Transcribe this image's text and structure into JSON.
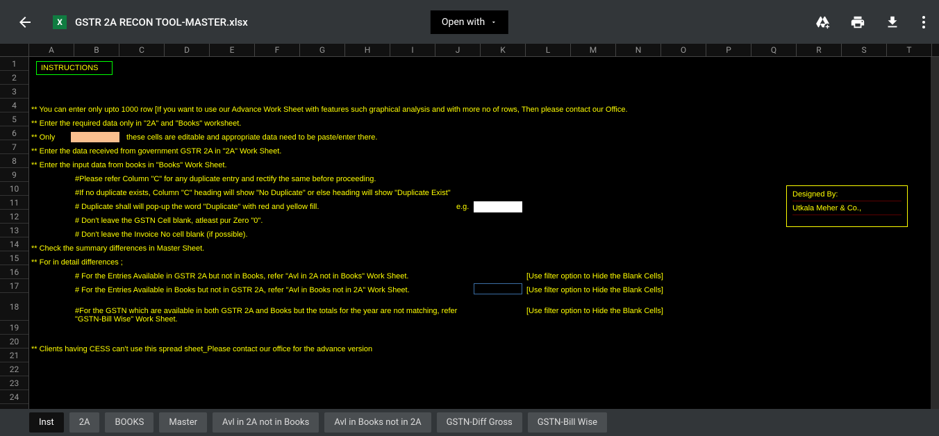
{
  "header": {
    "filename": "GSTR 2A RECON TOOL-MASTER.xlsx",
    "file_badge": "X",
    "open_with_label": "Open with"
  },
  "columns": [
    "A",
    "B",
    "C",
    "D",
    "E",
    "F",
    "G",
    "H",
    "I",
    "J",
    "K",
    "L",
    "M",
    "N",
    "O",
    "P",
    "Q",
    "R",
    "S",
    "T"
  ],
  "rows": [
    {
      "n": "1",
      "h": 20
    },
    {
      "n": "2",
      "h": 20
    },
    {
      "n": "3",
      "h": 20
    },
    {
      "n": "4",
      "h": 20
    },
    {
      "n": "5",
      "h": 20
    },
    {
      "n": "6",
      "h": 20
    },
    {
      "n": "7",
      "h": 20
    },
    {
      "n": "8",
      "h": 20
    },
    {
      "n": "9",
      "h": 20
    },
    {
      "n": "10",
      "h": 20
    },
    {
      "n": "11",
      "h": 20
    },
    {
      "n": "12",
      "h": 20
    },
    {
      "n": "13",
      "h": 20
    },
    {
      "n": "14",
      "h": 20
    },
    {
      "n": "15",
      "h": 20
    },
    {
      "n": "16",
      "h": 20
    },
    {
      "n": "17",
      "h": 20
    },
    {
      "n": "18",
      "h": 40
    },
    {
      "n": "19",
      "h": 20
    },
    {
      "n": "20",
      "h": 20
    },
    {
      "n": "21",
      "h": 20
    },
    {
      "n": "22",
      "h": 20
    },
    {
      "n": "23",
      "h": 20
    },
    {
      "n": "24",
      "h": 20
    }
  ],
  "instructions_label": "INSTRUCTIONS",
  "lines": {
    "l4": "** You can enter only upto 1000 row [If you want to use our Advance Work Sheet with features such graphical analysis and with more no of rows, Then please contact our Office.",
    "l5": "** Enter the required data only in \"2A\" and \"Books\" worksheet.",
    "l6a": "** Only",
    "l6b": "these cells are editable and appropriate data need to be paste/enter there.",
    "l7": "** Enter the data received from government GSTR 2A in \"2A\" Work Sheet.",
    "l8": "** Enter the input data from books in \"Books\" Work Sheet.",
    "l9": "#Please refer Column \"C\" for any duplicate entry and rectify the same before proceeding.",
    "l10": "#If no duplicate exists, Column \"C\" heading will show \"No Duplicate\" or else heading will show \"Duplicate Exist\"",
    "l11": "# Duplicate shall will pop-up the word \"Duplicate\" with red and yellow fill.",
    "l11eg": "e.g.",
    "l12": "# Don't leave the GSTN Cell blank, atleast pur Zero \"0\".",
    "l13": "# Don't leave the Invoice No cell blank (if possible).",
    "l14": "** Check the summary differences in Master Sheet.",
    "l15": "** For in detail differences ;",
    "l16": "# For the Entries Available in GSTR 2A but not in Books, refer \"Avl in 2A not in Books\" Work Sheet.",
    "l16b": "[Use filter option to Hide the Blank Cells]",
    "l17": "# For the Entries Available in Books but not in GSTR 2A, refer \"Avl in Books not in 2A\" Work Sheet.",
    "l17b": "[Use filter option to Hide the Blank Cells]",
    "l18": "#For the GSTN which are available in both GSTR 2A and Books but the totals for the year are not matching, refer \"GSTN-Bill Wise\" Work Sheet.",
    "l18b": "[Use filter option to Hide the Blank Cells]",
    "l20": "** Clients having  CESS can't use this spread sheet_Please contact our office for the advance version"
  },
  "designed": {
    "by": "Designed By:",
    "name": "Utkala Meher & Co.,"
  },
  "tabs": [
    "Inst",
    "2A",
    "BOOKS",
    "Master",
    "Avl in 2A not in Books",
    "Avl in Books not in 2A",
    "GSTN-Diff Gross",
    "GSTN-Bill Wise"
  ],
  "active_tab": 0
}
